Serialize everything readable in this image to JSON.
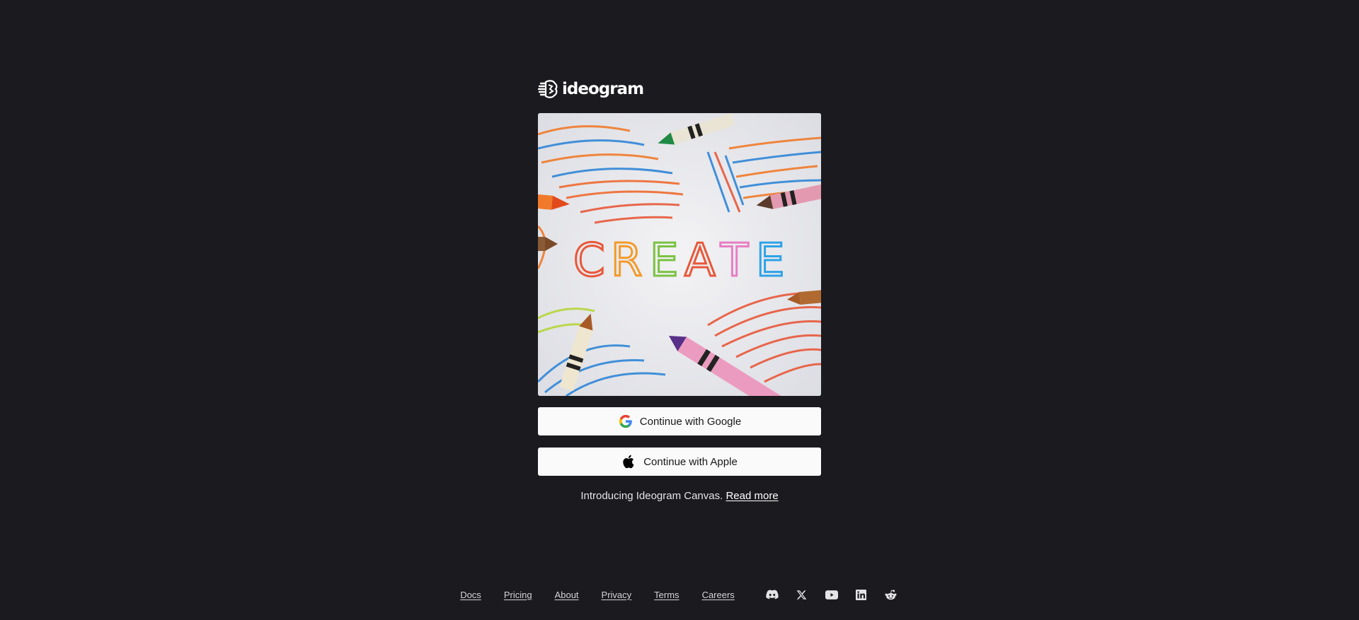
{
  "brand": {
    "name": "ideogram",
    "icon": "brain-logo-icon"
  },
  "hero": {
    "alt": "Crayon drawing with the word CREATE",
    "word": "CREATE",
    "letter_colors": [
      "#e8583a",
      "#f39a2b",
      "#7cc243",
      "#e8583a",
      "#e77fc4",
      "#2fa3e6"
    ]
  },
  "auth": {
    "google_label": "Continue with Google",
    "google_icon": "google-g-icon",
    "apple_label": "Continue with Apple",
    "apple_icon": "apple-icon"
  },
  "announcement": {
    "text": "Introducing Ideogram Canvas.",
    "link_label": "Read more"
  },
  "footer": {
    "links": [
      {
        "label": "Docs"
      },
      {
        "label": "Pricing"
      },
      {
        "label": "About"
      },
      {
        "label": "Privacy"
      },
      {
        "label": "Terms"
      },
      {
        "label": "Careers"
      }
    ],
    "socials": [
      "discord-icon",
      "x-icon",
      "youtube-icon",
      "linkedin-icon",
      "reddit-icon"
    ]
  },
  "colors": {
    "background": "#1a1a1f",
    "button_bg": "#fafafa",
    "button_text": "#18181b"
  }
}
